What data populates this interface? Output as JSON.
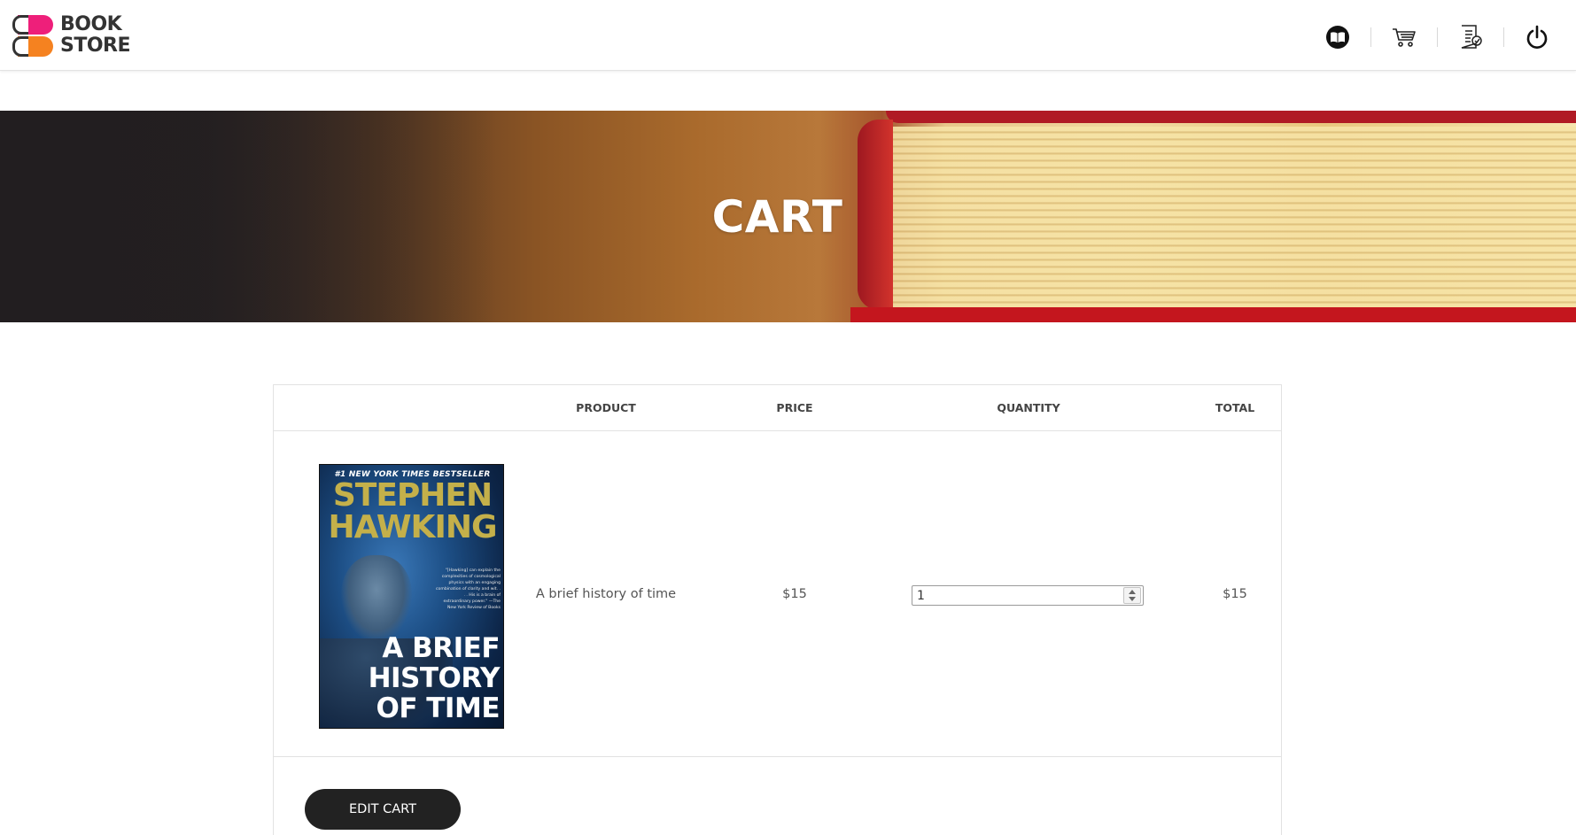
{
  "brand": {
    "line1": "BOOK",
    "line2": "STORE",
    "colors": {
      "top": "#ee1f7a",
      "bottom": "#f58220"
    }
  },
  "nav": [
    {
      "name": "books-icon"
    },
    {
      "name": "cart-icon"
    },
    {
      "name": "orders-icon"
    },
    {
      "name": "logout-icon"
    }
  ],
  "banner": {
    "title": "CART"
  },
  "cart": {
    "headers": {
      "product": "PRODUCT",
      "price": "PRICE",
      "quantity": "QUANTITY",
      "total": "TOTAL"
    },
    "items": [
      {
        "cover": {
          "tag": "#1 NEW YORK TIMES BESTSELLER",
          "author": "STEPHEN HAWKING",
          "blurb": "\"[Hawking] can explain the complexities of cosmological physics with an engaging combination of clarity and wit. . . . His is a brain of extraordinary power.\" —The New York Review of Books",
          "title": "A BRIEF\nHISTORY\nOF TIME"
        },
        "product": "A brief history of time",
        "price": "$15",
        "quantity": "1",
        "total": "$15"
      }
    ],
    "edit_label": "EDIT CART"
  }
}
